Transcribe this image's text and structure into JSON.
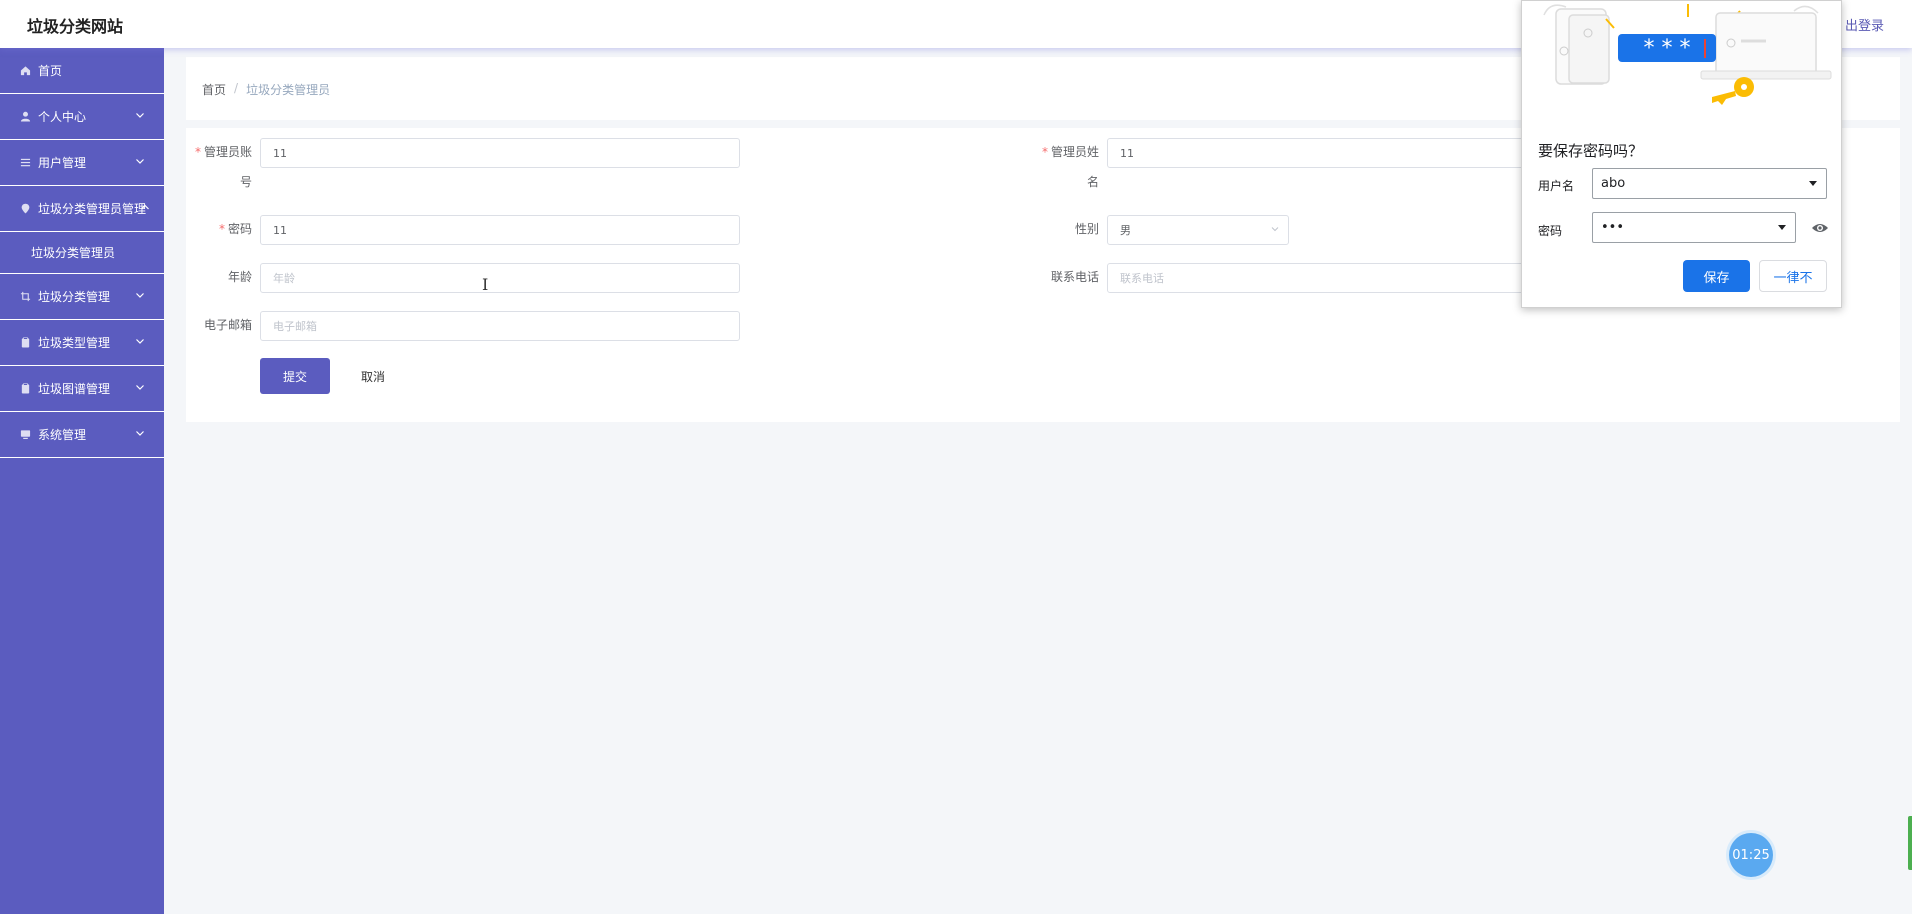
{
  "header": {
    "site_title": "垃圾分类网站",
    "logout_label": "出登录"
  },
  "sidebar": {
    "items": [
      {
        "label": "首页",
        "icon": "home-icon"
      },
      {
        "label": "个人中心",
        "icon": "person-icon"
      },
      {
        "label": "用户管理",
        "icon": "list-icon"
      },
      {
        "label": "垃圾分类管理员管理",
        "icon": "location-icon"
      },
      {
        "label": "垃圾分类管理",
        "icon": "crop-icon"
      },
      {
        "label": "垃圾类型管理",
        "icon": "clipboard-icon"
      },
      {
        "label": "垃圾图谱管理",
        "icon": "clipboard-icon"
      },
      {
        "label": "系统管理",
        "icon": "monitor-icon"
      }
    ],
    "sub_items": [
      {
        "label": "垃圾分类管理员"
      }
    ]
  },
  "breadcrumb": {
    "home": "首页",
    "separator": "/",
    "current": "垃圾分类管理员"
  },
  "form": {
    "account_label_line1": "管理员账",
    "account_label_line2": "号",
    "account_value": "11",
    "name_label_line1": "管理员姓",
    "name_label_line2": "名",
    "name_value": "11",
    "password_label": "密码",
    "password_value": "11",
    "gender_label": "性别",
    "gender_value": "男",
    "age_label": "年龄",
    "age_placeholder": "年龄",
    "phone_label": "联系电话",
    "phone_placeholder": "联系电话",
    "email_label": "电子邮箱",
    "email_placeholder": "电子邮箱",
    "required_mark": "*",
    "submit_label": "提交",
    "cancel_label": "取消"
  },
  "password_popup": {
    "illustration_text": "* * *",
    "title": "要保存密码吗？",
    "username_label": "用户名",
    "username_value": "abo",
    "password_label": "密码",
    "password_value": "•••",
    "save_label": "保存",
    "never_label": "一律不"
  },
  "timer": {
    "value": "01:25"
  },
  "colors": {
    "sidebar_bg": "#5b5cbf",
    "primary": "#5b5cbf",
    "popup_blue": "#1a73e8",
    "required": "#f56c6c",
    "timer": "#5aa9f0"
  }
}
